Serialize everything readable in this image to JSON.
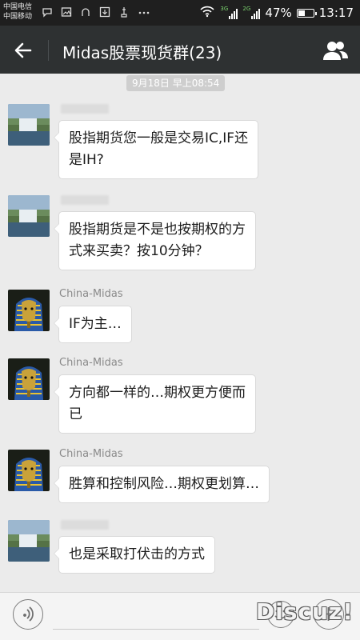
{
  "status_bar": {
    "carrier_1": "中国电信",
    "carrier_2": "中国移动",
    "network_1": "3G",
    "network_2": "2G",
    "battery": "47%",
    "battery_level": 0.47,
    "time": "13:17"
  },
  "header": {
    "title": "Midas股票现货群(23)",
    "back_icon": "arrow-left-icon",
    "members_icon": "group-icon"
  },
  "chat": {
    "timestamp": "9月18日 早上08:54",
    "messages": [
      {
        "sender": "",
        "text_lines": [
          "股指期货您一般是交易IC,IF还",
          "是IH?"
        ],
        "avatar": "waterfall-avatar"
      },
      {
        "sender": "",
        "text_lines": [
          "股指期货是不是也按期权的方",
          "式来买卖？按10分钟？"
        ],
        "avatar": "waterfall-avatar"
      },
      {
        "sender": "China-Midas",
        "text_lines": [
          "IF为主…"
        ],
        "avatar": "pharaoh-avatar"
      },
      {
        "sender": "China-Midas",
        "text_lines": [
          "方向都一样的…期权更方便而",
          "已"
        ],
        "avatar": "pharaoh-avatar"
      },
      {
        "sender": "China-Midas",
        "text_lines": [
          "胜算和控制风险…期权更划算…"
        ],
        "avatar": "pharaoh-avatar"
      },
      {
        "sender": "",
        "text_lines": [
          "也是采取打伏击的方式"
        ],
        "avatar": "waterfall-avatar"
      }
    ]
  },
  "input_bar": {
    "voice_icon": "voice-icon",
    "emoji_icon": "emoji-icon",
    "plus_icon": "plus-icon",
    "input_value": ""
  },
  "watermark": "Discuz!",
  "colors": {
    "status_bg": "#1f1f1f",
    "header_bg": "#2e3132",
    "chat_bg": "#ebebeb",
    "bubble_bg": "#ffffff"
  }
}
